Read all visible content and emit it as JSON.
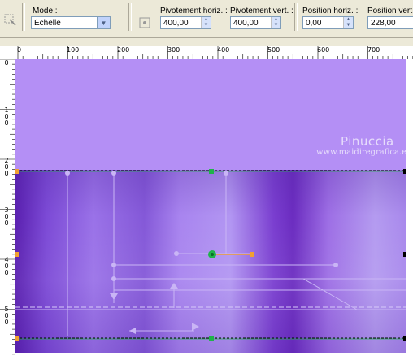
{
  "toolbar": {
    "mode_label": "Mode :",
    "mode_value": "Échelle",
    "pivot_h_label": "Pivotement horiz. :",
    "pivot_h_value": "400,00",
    "pivot_v_label": "Pivotement vert. :",
    "pivot_v_value": "400,00",
    "pos_h_label": "Position horiz. :",
    "pos_h_value": "0,00",
    "pos_v_label": "Position vert. :",
    "pos_v_value": "228,00"
  },
  "ruler_top": [
    "0",
    "100",
    "200",
    "300",
    "400",
    "500",
    "600",
    "700"
  ],
  "ruler_left": [
    "0",
    "100",
    "200",
    "300",
    "400",
    "500"
  ],
  "watermark": {
    "title": "Pinuccia",
    "url": "www.maidiregrafica.eu"
  },
  "colors": {
    "canvas_top": "#b48ff5",
    "canvas_gradient_dark": "#6b2cc0",
    "handle_green": "#1fb34a",
    "handle_orange": "#f0a030",
    "guide_line": "#c9b5f5"
  }
}
